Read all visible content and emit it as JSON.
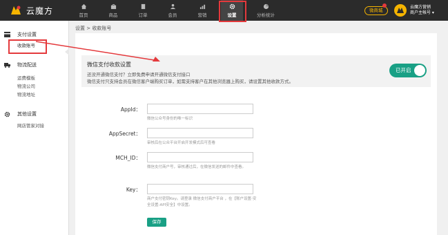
{
  "app": {
    "name": "云魔方"
  },
  "nav": [
    {
      "label": "首页",
      "icon": "home-icon"
    },
    {
      "label": "商品",
      "icon": "bag-icon"
    },
    {
      "label": "订单",
      "icon": "document-icon"
    },
    {
      "label": "会员",
      "icon": "user-icon"
    },
    {
      "label": "营销",
      "icon": "chart-bars-icon"
    },
    {
      "label": "设置",
      "icon": "gear-icon",
      "active": true
    },
    {
      "label": "分析统计",
      "icon": "pie-icon"
    }
  ],
  "header": {
    "shop_label": "微商城",
    "user_name": "云魔方营销",
    "user_role": "商户主帐号"
  },
  "sidebar": {
    "groups": [
      {
        "label": "支付设置",
        "icon": "card-icon",
        "items": [
          "收款账号"
        ]
      },
      {
        "label": "物流配送",
        "icon": "truck-icon",
        "items": [
          "运费模板",
          "物流公司",
          "物流地址"
        ]
      },
      {
        "label": "其他设置",
        "icon": "gear-icon",
        "items": [
          "网店管家对接"
        ]
      }
    ],
    "active_item": "收款账号"
  },
  "breadcrumb": "设置 > 收款账号",
  "notice": {
    "title": "微信支付收款设置",
    "line1": "还没开通微信支付？立即免费申请开通微信支付接口",
    "line2": "微信支付只支持会员在微信客户端购买订单，如需支持客户在其他浏览器上购买，请设置其他收款方式。",
    "toggle_label": "已开启",
    "enabled": true
  },
  "form": {
    "fields": [
      {
        "label": "AppId：",
        "value": "",
        "help": "微信公众号身份的唯一标识"
      },
      {
        "label": "AppSecret：",
        "value": "",
        "help": "审核后在公众平台开启开发模式后可查看"
      },
      {
        "label": "MCH_ID：",
        "value": "",
        "help": "微信支付商户号，审核通过后，在微信发送的邮件中查看。"
      },
      {
        "label": "Key：",
        "value": "",
        "help": "商户支付密钥Key。请登录 微信支付商户平台 ，在【账户设置-安全设置-API安全】中设置。"
      }
    ],
    "save_label": "保存"
  },
  "colors": {
    "accent": "#19a085",
    "highlight": "#e4393c",
    "brand": "#f5b400",
    "topbar": "#2b2b2b"
  }
}
